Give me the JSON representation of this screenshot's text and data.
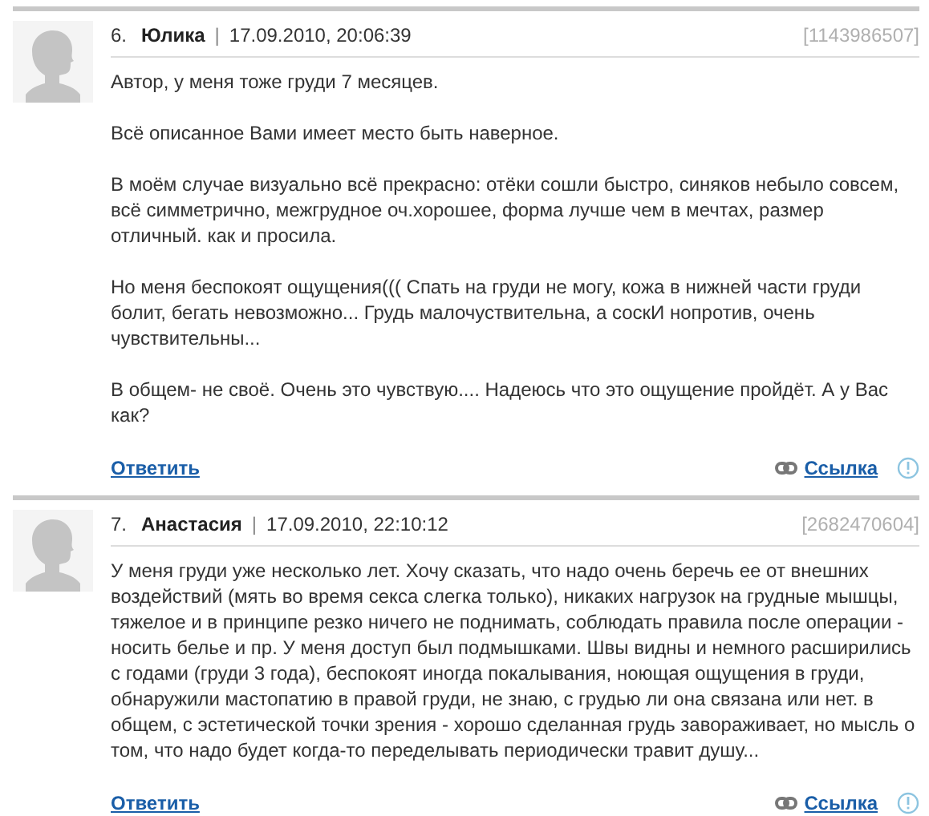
{
  "comments": [
    {
      "number": "6.",
      "author": "Юлика",
      "separator": "|",
      "date": "17.09.2010, 20:06:39",
      "id": "[1143986507]",
      "paragraphs": [
        "Автор, у меня тоже груди 7 месяцев.",
        "Всё описанное Вами имеет место быть наверное.",
        "В моём случае визуально всё прекрасно: отёки сошли быстро, синяков небыло совсем, всё симметрично, межгрудное оч.хорошее, форма лучше чем в мечтах, размер отличный. как и просила.",
        "Но меня беспокоят ощущения((( Спать на груди не могу, кожа в нижней части груди болит, бегать невозможно... Грудь малочуствительна, а соскИ нопротив, очень чувствительны...",
        "В общем- не своё. Очень это чувствую.... Надеюсь что это ощущение пройдёт. А у Вас как?"
      ],
      "reply": "Ответить",
      "link": "Ссылка"
    },
    {
      "number": "7.",
      "author": "Анастасия",
      "separator": "|",
      "date": "17.09.2010, 22:10:12",
      "id": "[2682470604]",
      "paragraphs": [
        "У меня груди уже несколько лет. Хочу сказать, что надо очень беречь ее от внешних воздействий (мять во время секса слегка только), никаких нагрузок на грудные мышцы, тяжелое и в принципе резко ничего не поднимать, соблюдать правила после операции - носить белье и пр. У меня доступ был подмышками. Швы видны и немного расширились с годами (груди 3 года), беспокоят иногда покалывания, ноющая ощущения в груди, обнаружили мастопатию в правой груди, не знаю, с грудью ли она связана или нет. в общем, с эстетической точки зрения - хорошо сделанная грудь завораживает, но мысль о том, что надо будет когда-то переделывать периодически травит душу..."
      ],
      "reply": "Ответить",
      "link": "Ссылка"
    }
  ]
}
